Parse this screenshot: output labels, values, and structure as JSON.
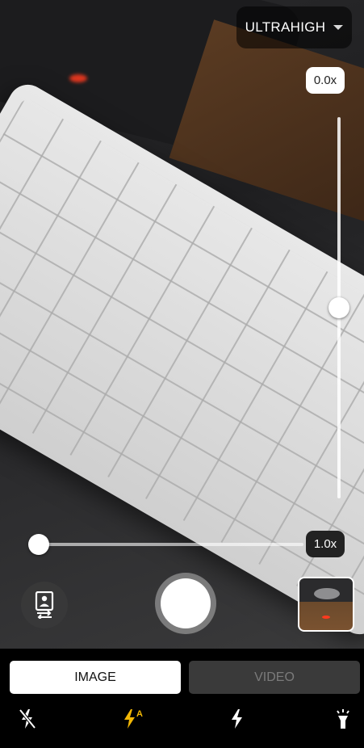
{
  "resolution": {
    "label": "ULTRAHIGH",
    "icon": "dropdown-arrow-icon"
  },
  "zoom": {
    "vertical": {
      "label": "0.0x",
      "level": 0.5
    },
    "horizontal": {
      "label": "1.0x",
      "level": 0.0
    }
  },
  "controls": {
    "switch_camera_icon": "switch-camera-icon",
    "shutter_icon": "shutter-button",
    "gallery_icon": "gallery-thumbnail"
  },
  "modes": {
    "image": "IMAGE",
    "video": "VIDEO",
    "selected": "IMAGE"
  },
  "flash": {
    "items": [
      {
        "name": "flash-off-icon",
        "active": false
      },
      {
        "name": "flash-auto-icon",
        "active": true
      },
      {
        "name": "flash-on-icon",
        "active": false
      },
      {
        "name": "torch-icon",
        "active": false
      }
    ],
    "active_color": "#f2b705",
    "inactive_color": "#ffffff"
  }
}
